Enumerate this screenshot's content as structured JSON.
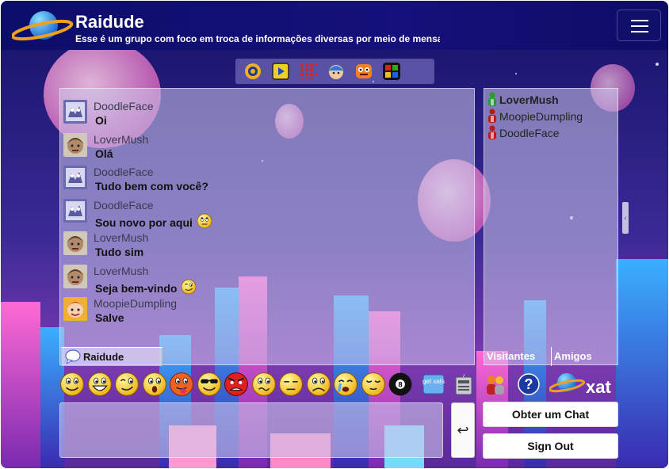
{
  "header": {
    "title": "Raidude",
    "subtitle": "Esse é um grupo com foco em troca de informações diversas por meio de mensag",
    "menu_icon": "hamburger-icon"
  },
  "toolbar": {
    "icons": [
      "xat-ring-icon",
      "media-player-icon",
      "grid-dots-icon",
      "blue-avatar-icon",
      "orange-face-icon",
      "four-squares-icon"
    ]
  },
  "messages": [
    {
      "user": "DoodleFace",
      "text": "Oi",
      "smiley": ""
    },
    {
      "user": "LoverMush",
      "text": "Olá",
      "smiley": ""
    },
    {
      "user": "DoodleFace",
      "text": "Tudo bem com você?",
      "smiley": ""
    },
    {
      "user": "DoodleFace",
      "text": "Sou novo por aqui",
      "smiley": "rolling-eyes"
    },
    {
      "user": "LoverMush",
      "text": "Tudo sim",
      "smiley": ""
    },
    {
      "user": "LoverMush",
      "text": "Seja bem-vindo",
      "smiley": "wink"
    },
    {
      "user": "MoopieDumpling",
      "text": "Salve",
      "smiley": ""
    }
  ],
  "chat_tab": {
    "label": "Raidude"
  },
  "users": [
    {
      "name": "LoverMush",
      "bold": true,
      "color": "#2a9a2a"
    },
    {
      "name": "MoopieDumpling",
      "bold": false,
      "color": "#c01818"
    },
    {
      "name": "DoodleFace",
      "bold": false,
      "color": "#c01818"
    }
  ],
  "user_tabs": {
    "visitors": "Visitantes",
    "friends": "Amigos"
  },
  "smileys": [
    "smile",
    "big-grin",
    "wink",
    "surprised",
    "tongue",
    "cool",
    "angry",
    "confused",
    "sleepy",
    "sad",
    "crying",
    "pleased"
  ],
  "extras": {
    "getxats_label": "get xats",
    "xat_logo": "xat"
  },
  "input": {
    "value": "",
    "placeholder": ""
  },
  "buttons": {
    "send": "↩",
    "get_chat": "Obter um Chat",
    "sign_out": "Sign Out"
  }
}
